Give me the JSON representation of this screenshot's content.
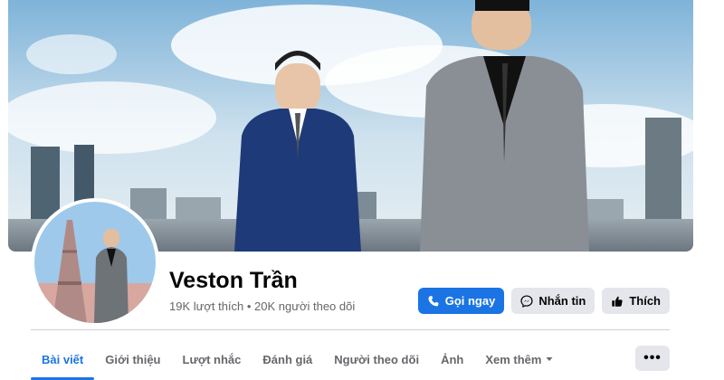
{
  "profile": {
    "name": "Veston Trần",
    "stats": "19K lượt thích • 20K người theo dõi"
  },
  "actions": {
    "call_label": "Gọi ngay",
    "message_label": "Nhắn tin",
    "like_label": "Thích"
  },
  "tabs": [
    {
      "label": "Bài viết",
      "active": true
    },
    {
      "label": "Giới thiệu"
    },
    {
      "label": "Lượt nhắc"
    },
    {
      "label": "Đánh giá"
    },
    {
      "label": "Người theo dõi"
    },
    {
      "label": "Ảnh"
    },
    {
      "label": "Xem thêm",
      "icon": "caret-down-icon"
    }
  ],
  "more_button": {
    "label": "•••"
  },
  "colors": {
    "primary": "#1b74e4",
    "secondary_button": "#e4e6eb",
    "text": "#050505",
    "muted_text": "#65676b"
  },
  "icons": {
    "call": "phone-icon",
    "message": "messenger-icon",
    "like": "thumbs-up-icon",
    "more": "more-dots-icon"
  }
}
